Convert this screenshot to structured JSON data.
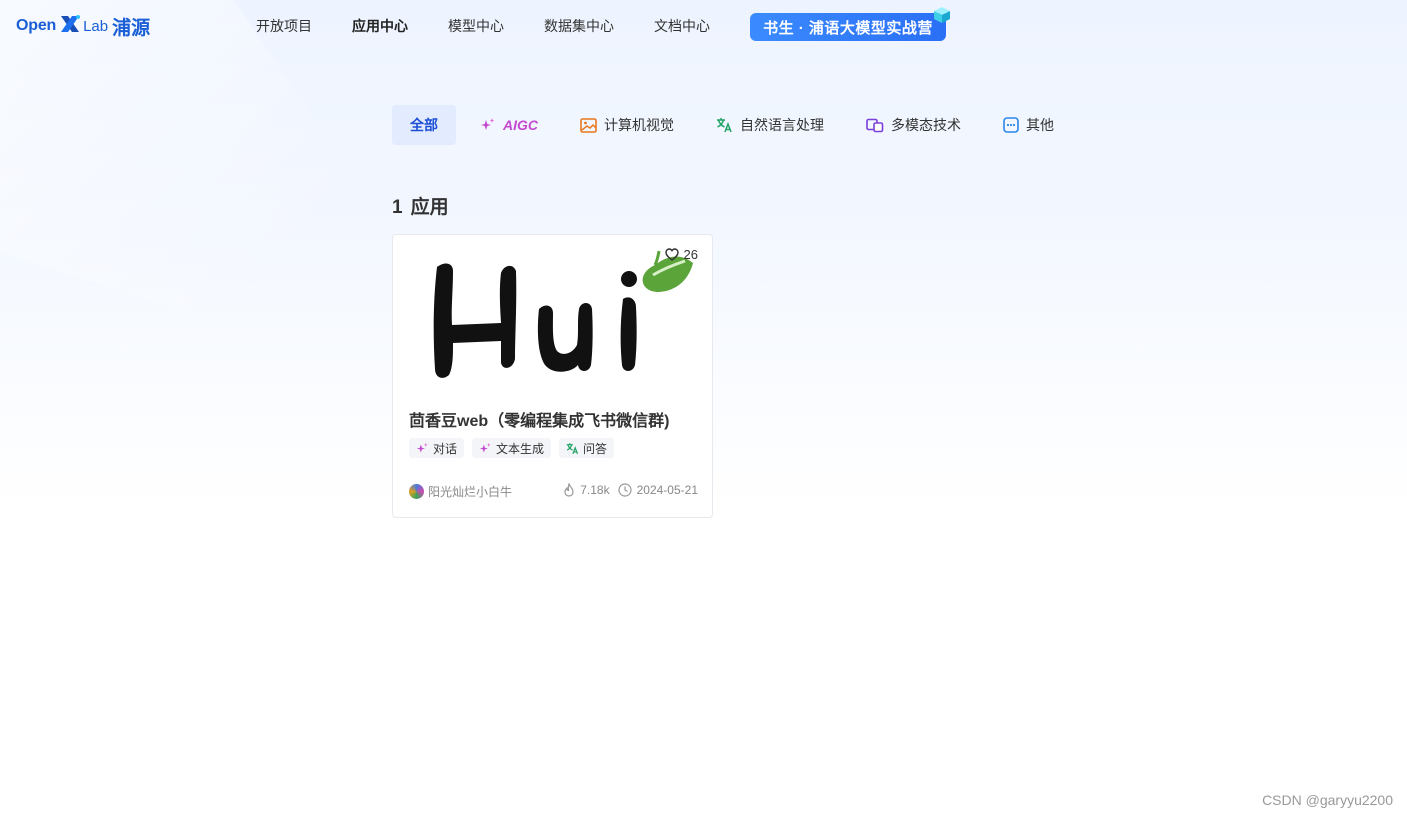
{
  "header": {
    "logo": {
      "open": "Open",
      "lab": "Lab",
      "cn": "浦源"
    },
    "nav": [
      {
        "label": "开放项目",
        "active": false
      },
      {
        "label": "应用中心",
        "active": true
      },
      {
        "label": "模型中心",
        "active": false
      },
      {
        "label": "数据集中心",
        "active": false
      },
      {
        "label": "文档中心",
        "active": false
      }
    ],
    "promo_label": "书生 · 浦语大模型实战营"
  },
  "tabs": [
    {
      "label": "全部",
      "icon": "none",
      "active": true
    },
    {
      "label": "AIGC",
      "icon": "sparkle-icon",
      "color": "#c44bd0"
    },
    {
      "label": "计算机视觉",
      "icon": "image-icon",
      "color": "#e8781e"
    },
    {
      "label": "自然语言处理",
      "icon": "translate-icon",
      "color": "#21a366"
    },
    {
      "label": "多模态技术",
      "icon": "multimodal-icon",
      "color": "#7a3fd8"
    },
    {
      "label": "其他",
      "icon": "more-icon",
      "color": "#2a86e8"
    }
  ],
  "result": {
    "count": "1",
    "label": "应用"
  },
  "card": {
    "likes": "26",
    "image_text": "Hui",
    "title": "茴香豆web（零编程集成飞书微信群)",
    "tags": [
      {
        "label": "对话",
        "icon": "sparkle-icon"
      },
      {
        "label": "文本生成",
        "icon": "sparkle-icon"
      },
      {
        "label": "问答",
        "icon": "translate-icon"
      }
    ],
    "author": "阳光灿烂小白牛",
    "views": "7.18k",
    "date": "2024-05-21"
  },
  "watermark": "CSDN @garyyu2200",
  "colors": {
    "accent": "#1d4fd6",
    "promo": "#2a6ff5",
    "aigc": "#c44bd0",
    "leaf": "#5aa43a"
  }
}
